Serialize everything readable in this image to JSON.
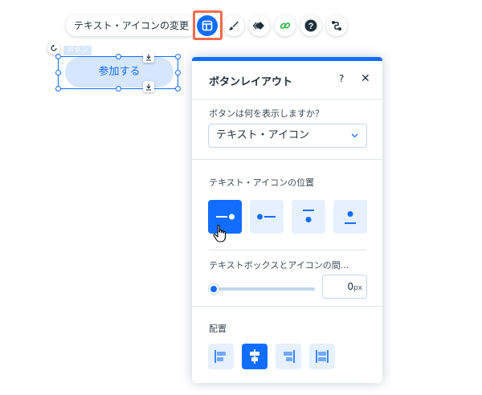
{
  "toolbar": {
    "change_text_icon_label": "テキスト・アイコンの変更",
    "buttons": [
      {
        "name": "layout-icon",
        "active": true
      },
      {
        "name": "design-brush-icon"
      },
      {
        "name": "animation-icon"
      },
      {
        "name": "link-icon"
      },
      {
        "name": "help-icon"
      },
      {
        "name": "connect-icon"
      }
    ],
    "accent_color": "#116dff",
    "highlight_color": "#f26b4c"
  },
  "canvas": {
    "component_tag": "ボタン",
    "button_text": "参加する"
  },
  "panel": {
    "title": "ボタンレイアウト",
    "help": "?",
    "close": "✕",
    "display_label": "ボタンは何を表示しますか？",
    "display_selected": "テキスト・アイコン",
    "position_label": "テキスト・アイコンの位置",
    "position_options": [
      {
        "name": "text-left-icon-right",
        "selected": true
      },
      {
        "name": "icon-left-text-right",
        "selected": false
      },
      {
        "name": "text-top-icon-bottom",
        "selected": false
      },
      {
        "name": "icon-top-text-bottom",
        "selected": false
      }
    ],
    "spacing_label": "テキストボックスとアイコンの間...",
    "spacing_value": "0",
    "spacing_unit": "px",
    "alignment_label": "配置",
    "alignment_options": [
      {
        "name": "align-left",
        "selected": false
      },
      {
        "name": "align-center",
        "selected": true
      },
      {
        "name": "align-right",
        "selected": false
      },
      {
        "name": "align-justify",
        "selected": false
      }
    ]
  }
}
